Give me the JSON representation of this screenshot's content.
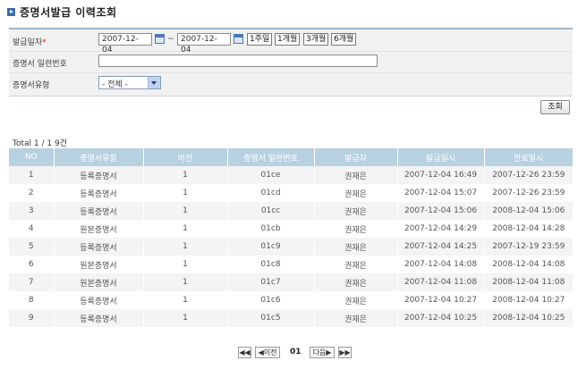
{
  "header": {
    "title": "증명서발급 이력조회"
  },
  "search": {
    "issue_date_label": "발급일자",
    "required_mark": "*",
    "date_from": "2007-12-04",
    "date_to": "2007-12-04",
    "tilde": "~",
    "period_buttons": [
      "1주일",
      "1개월",
      "3개월",
      "6개월"
    ],
    "serial_label": "증명서 일련번호",
    "serial_value": "",
    "type_label": "증명서유형",
    "type_selected": "- 전체 -",
    "submit_label": "조회"
  },
  "summary": {
    "total_text": "Total 1 / 1  9건"
  },
  "table": {
    "columns": [
      "NO",
      "증명서유형",
      "버전",
      "증명서 일련번호",
      "발급자",
      "발급일시",
      "만료일시"
    ],
    "rows": [
      [
        "1",
        "등록증명서",
        "1",
        "01ce",
        "권재은",
        "2007-12-04 16:49",
        "2007-12-26 23:59"
      ],
      [
        "2",
        "등록증명서",
        "1",
        "01cd",
        "권재은",
        "2007-12-04 15:07",
        "2007-12-26 23:59"
      ],
      [
        "3",
        "등록증명서",
        "1",
        "01cc",
        "권재은",
        "2007-12-04 15:06",
        "2008-12-04 15:06"
      ],
      [
        "4",
        "원본증명서",
        "1",
        "01cb",
        "권재은",
        "2007-12-04 14:29",
        "2008-12-04 14:28"
      ],
      [
        "5",
        "등록증명서",
        "1",
        "01c9",
        "권재은",
        "2007-12-04 14:25",
        "2007-12-19 23:59"
      ],
      [
        "6",
        "원본증명서",
        "1",
        "01c8",
        "권재은",
        "2007-12-04 14:08",
        "2008-12-04 14:08"
      ],
      [
        "7",
        "원본증명서",
        "1",
        "01c7",
        "권재은",
        "2007-12-04 11:08",
        "2008-12-04 11:08"
      ],
      [
        "8",
        "등록증명서",
        "1",
        "01c6",
        "권재은",
        "2007-12-04 10:27",
        "2008-12-04 10:27"
      ],
      [
        "9",
        "등록증명서",
        "1",
        "01c5",
        "권재은",
        "2007-12-04 10:25",
        "2008-12-04 10:25"
      ]
    ]
  },
  "pagination": {
    "first": "◀◀",
    "prev": "◀이전",
    "current": "01",
    "next": "다음▶",
    "last": "▶▶"
  },
  "colors": {
    "header_bg": "#b7d1e0",
    "title_icon": "#3b6fa8",
    "search_bg": "#f1f1f1"
  }
}
